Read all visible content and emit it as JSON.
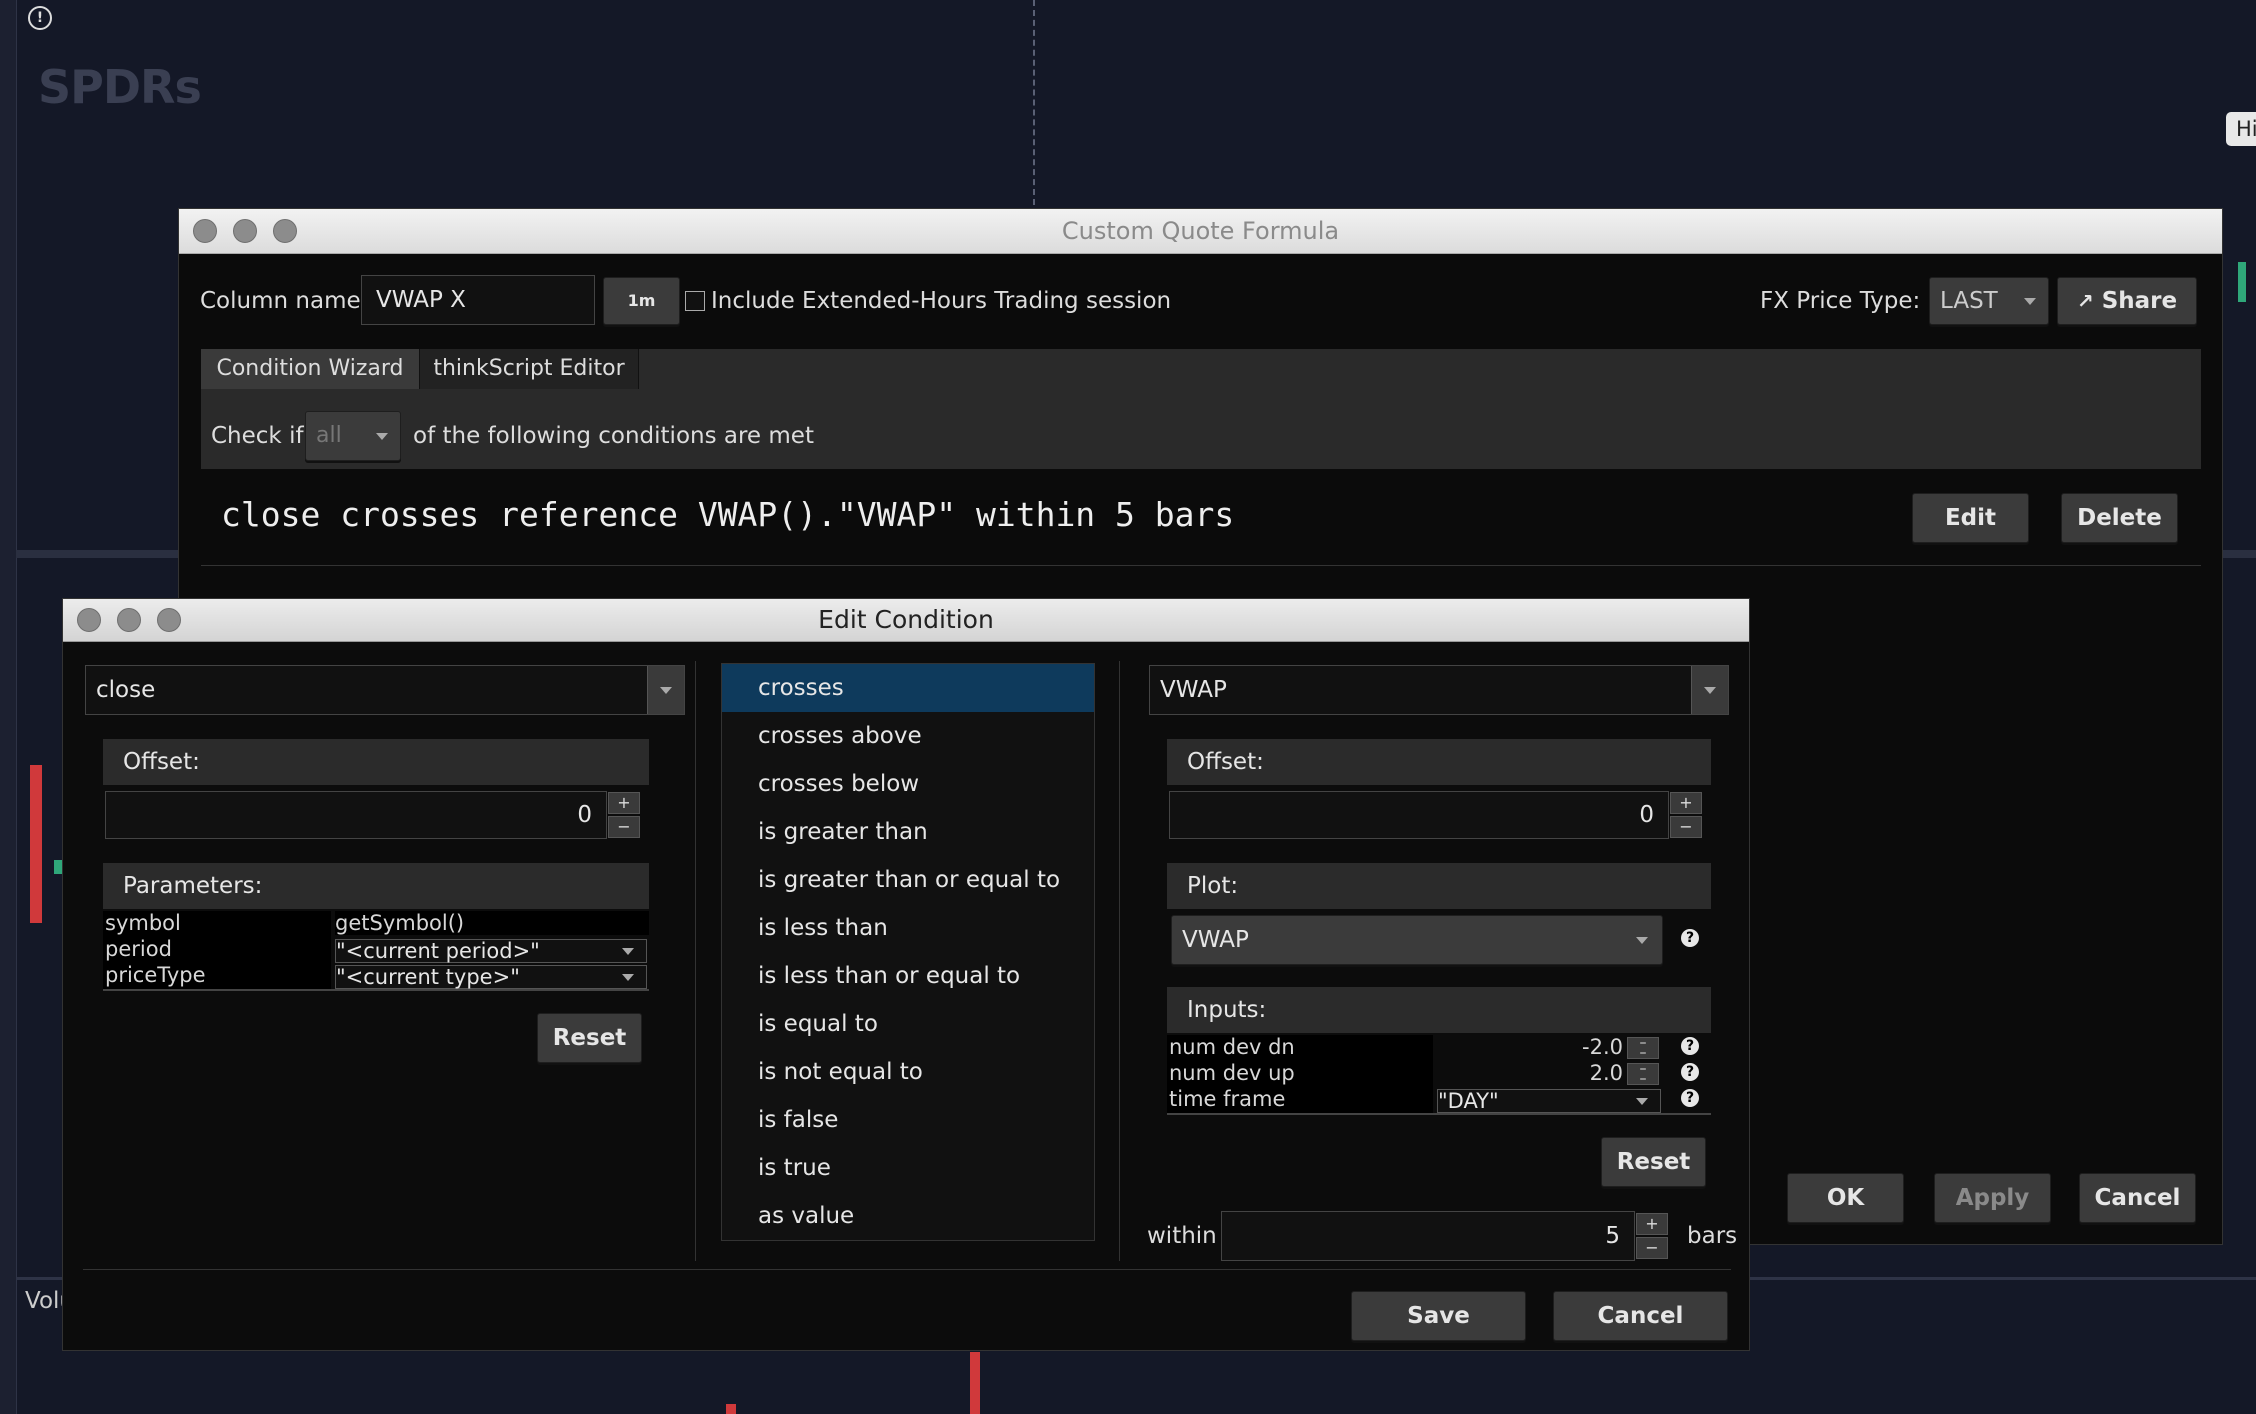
{
  "background": {
    "logo_text": "SPDRs",
    "hi_button": "Hi",
    "volume_label": "Volu"
  },
  "cqf": {
    "title": "Custom Quote Formula",
    "column_name_label": "Column name:",
    "column_name_value": "VWAP X",
    "aggregation": "1m",
    "extended_hours_label": "Include Extended-Hours Trading session",
    "fx_price_type_label": "FX Price Type:",
    "fx_price_type_value": "LAST",
    "share_label": "Share",
    "tabs": [
      "Condition Wizard",
      "thinkScript Editor"
    ],
    "check_if_label": "Check if",
    "check_if_value": "all",
    "conditions_met_label": "of the following conditions are met",
    "condition_text": "close crosses reference VWAP().\"VWAP\" within 5 bars",
    "edit_label": "Edit",
    "delete_label": "Delete",
    "ok_label": "OK",
    "apply_label": "Apply",
    "cancel_label": "Cancel"
  },
  "edit": {
    "title": "Edit Condition",
    "left": {
      "study_value": "close",
      "offset_label": "Offset:",
      "offset_value": "0",
      "parameters_label": "Parameters:",
      "params": [
        {
          "name": "symbol",
          "value": "getSymbol()"
        },
        {
          "name": "period",
          "value": "\"<current period>\""
        },
        {
          "name": "priceType",
          "value": "\"<current type>\""
        }
      ],
      "reset_label": "Reset"
    },
    "operators": [
      "crosses",
      "crosses above",
      "crosses below",
      "is greater than",
      "is greater than or equal to",
      "is less than",
      "is less than or equal to",
      "is equal to",
      "is not equal to",
      "is false",
      "is true",
      "as value"
    ],
    "selected_operator": "crosses",
    "right": {
      "study_value": "VWAP",
      "offset_label": "Offset:",
      "offset_value": "0",
      "plot_label": "Plot:",
      "plot_value": "VWAP",
      "inputs_label": "Inputs:",
      "inputs": [
        {
          "name": "num dev dn",
          "value": "-2.0"
        },
        {
          "name": "num dev up",
          "value": "2.0"
        },
        {
          "name": "time frame",
          "value": "\"DAY\""
        }
      ],
      "reset_label": "Reset",
      "within_label": "within",
      "within_value": "5",
      "bars_label": "bars"
    },
    "save_label": "Save",
    "cancel_label": "Cancel"
  }
}
